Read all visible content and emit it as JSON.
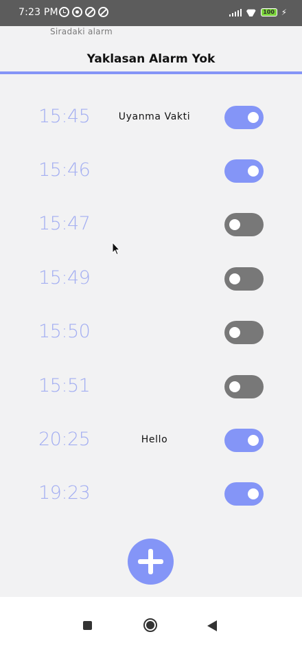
{
  "status_bar": {
    "time": "7:23 PM",
    "battery": "100",
    "icons_left": [
      "alarm-icon",
      "whatsapp-icon",
      "blocked-icon",
      "blocked-icon"
    ],
    "icons_right": [
      "signal-icon",
      "wifi-icon",
      "battery-icon",
      "charging-icon"
    ]
  },
  "header": {
    "subtitle": "Siradaki alarm",
    "title": "Yaklasan Alarm Yok",
    "accent_color": "#8495f7"
  },
  "alarms": [
    {
      "time": "15:45",
      "label": "Uyanma Vakti",
      "enabled": true
    },
    {
      "time": "15:46",
      "label": "",
      "enabled": true
    },
    {
      "time": "15:47",
      "label": "",
      "enabled": false
    },
    {
      "time": "15:49",
      "label": "",
      "enabled": false
    },
    {
      "time": "15:50",
      "label": "",
      "enabled": false
    },
    {
      "time": "15:51",
      "label": "",
      "enabled": false
    },
    {
      "time": "20:25",
      "label": "Hello",
      "enabled": true
    },
    {
      "time": "19:23",
      "label": "",
      "enabled": true
    }
  ],
  "fab": {
    "icon": "plus-icon"
  },
  "nav_bar": {
    "icons": [
      "recents-icon",
      "home-icon",
      "back-icon"
    ]
  },
  "colors": {
    "toggle_on": "#8495f7",
    "toggle_off": "#787878",
    "time_text": "#a3aef2"
  }
}
